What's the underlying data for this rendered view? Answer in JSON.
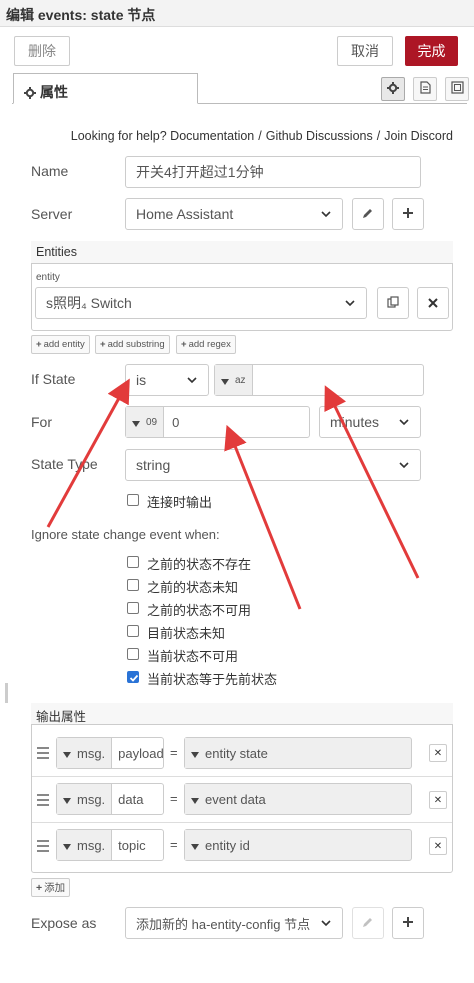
{
  "header": {
    "title": "编辑 events: state 节点"
  },
  "toolbar": {
    "delete_label": "删除",
    "cancel_label": "取消",
    "done_label": "完成"
  },
  "tabs": {
    "properties_label": "属性"
  },
  "help": {
    "prefix": "Looking for help?",
    "links": [
      "Documentation",
      "Github Discussions",
      "Join Discord"
    ]
  },
  "form": {
    "name_label": "Name",
    "name_value": "开关4打开超过1分钟",
    "server_label": "Server",
    "server_value": "Home Assistant",
    "entities": {
      "section_label": "Entities",
      "row_label": "entity",
      "entity_value": "s照明₄ Switch",
      "add_entity": "add entity",
      "add_substring": "add substring",
      "add_regex": "add regex"
    },
    "if_state_label": "If State",
    "if_state_operator": "is",
    "if_state_type_icon": "az",
    "if_state_value": "",
    "for_label": "For",
    "for_type_icon": "09",
    "for_value": "0",
    "for_unit": "minutes",
    "state_type_label": "State Type",
    "state_type_value": "string",
    "output_on_connect": "连接时输出",
    "ignore_label": "Ignore state change event when:",
    "ignore_options": [
      {
        "label": "之前的状态不存在",
        "checked": false
      },
      {
        "label": "之前的状态未知",
        "checked": false
      },
      {
        "label": "之前的状态不可用",
        "checked": false
      },
      {
        "label": "目前状态未知",
        "checked": false
      },
      {
        "label": "当前状态不可用",
        "checked": false
      },
      {
        "label": "当前状态等于先前状态",
        "checked": true
      }
    ],
    "output_properties": {
      "section_label": "输出属性",
      "rows": [
        {
          "prefix": "msg.",
          "property": "payload",
          "value": "entity state"
        },
        {
          "prefix": "msg.",
          "property": "data",
          "value": "event data"
        },
        {
          "prefix": "msg.",
          "property": "topic",
          "value": "entity id"
        }
      ],
      "add_label": "添加"
    },
    "expose_as_label": "Expose as",
    "expose_as_value": "添加新的 ha-entity-config 节点"
  },
  "colors": {
    "primary": "#ad1625",
    "annotation": "#e23b3b",
    "checkbox": "#2a73d6"
  }
}
